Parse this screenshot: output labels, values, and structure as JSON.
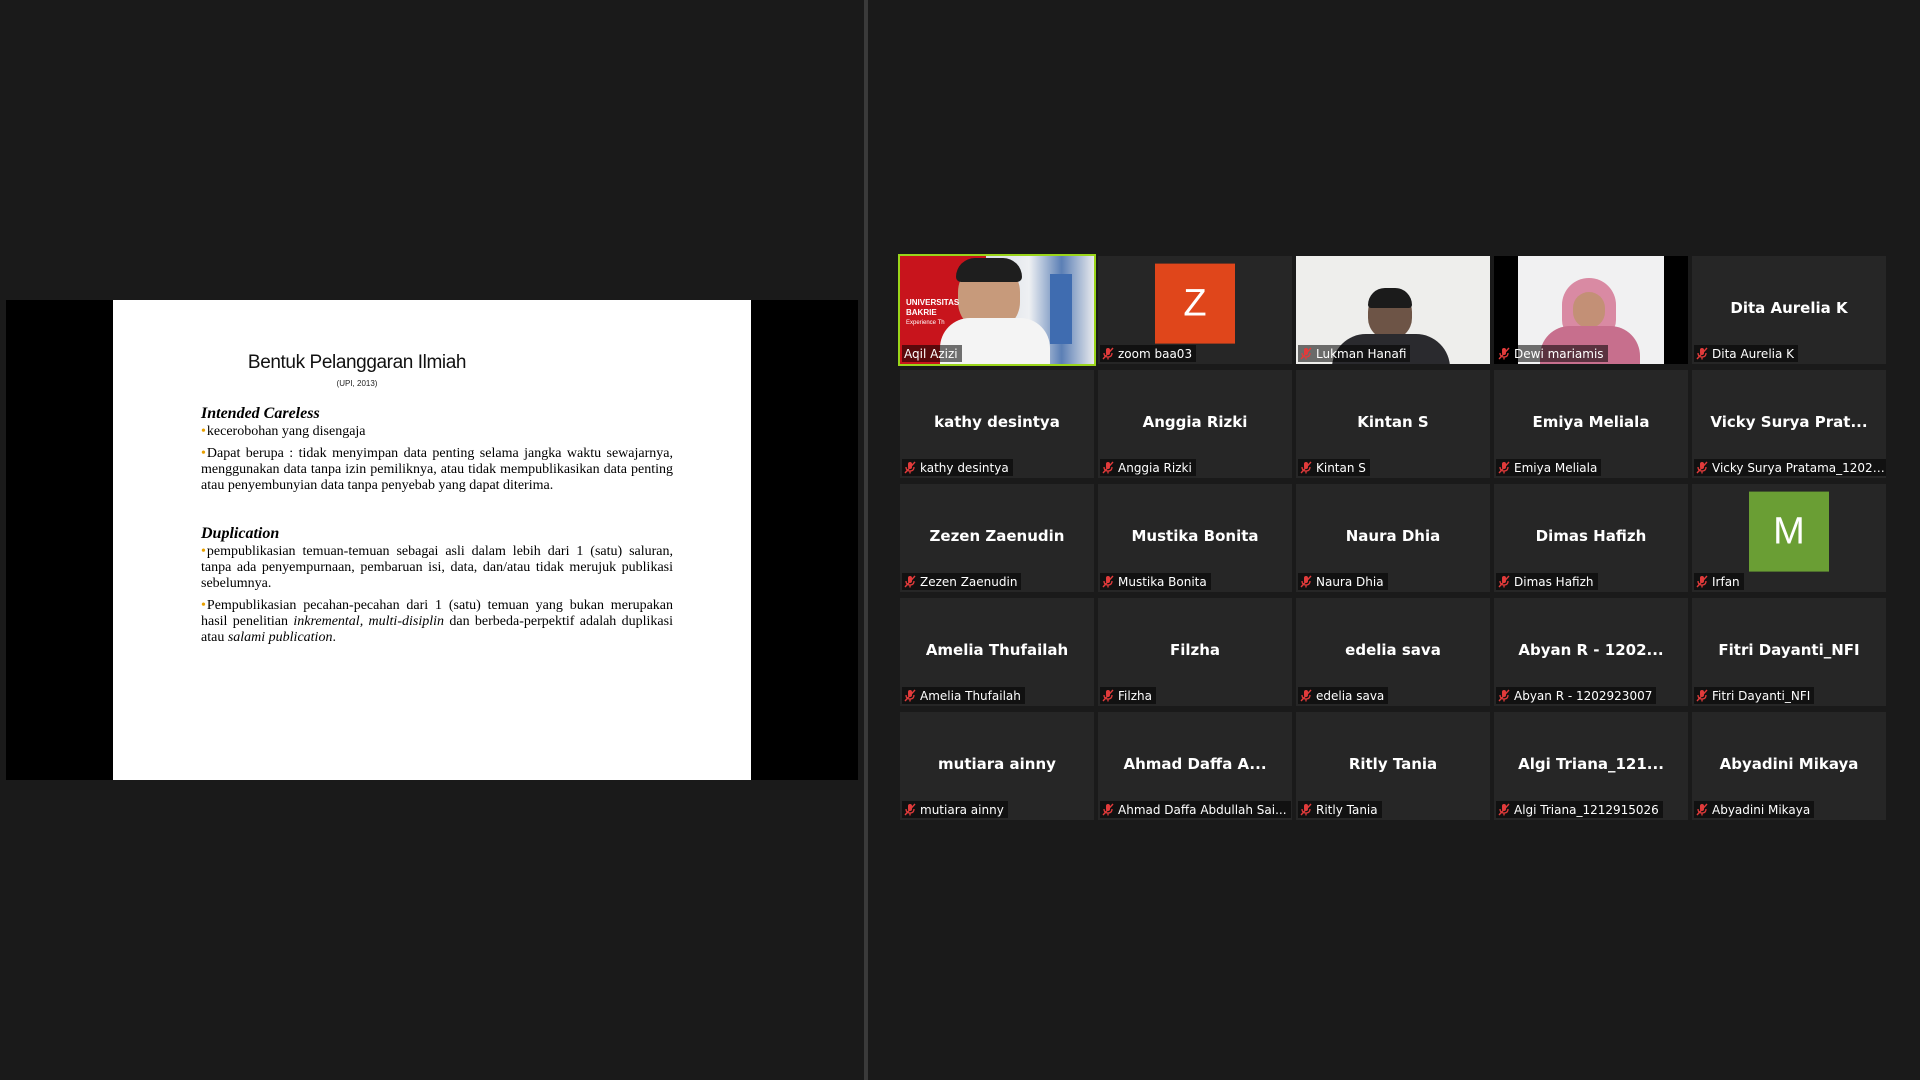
{
  "slide": {
    "title": "Bentuk Pelanggaran Ilmiah",
    "source": "(UPI, 2013)",
    "section1": {
      "heading": "Intended Careless",
      "bullet1": "kecerobohan yang disengaja",
      "bullet2": "Dapat berupa : tidak menyimpan data penting selama jangka waktu sewajarnya, menggunakan data tanpa izin pemiliknya, atau tidak mempublikasikan data penting atau penyembunyian data tanpa penyebab yang dapat diterima."
    },
    "section2": {
      "heading": "Duplication",
      "bullet1": "pempublikasian temuan-temuan sebagai asli dalam lebih dari 1 (satu) saluran, tanpa ada penyempurnaan, pembaruan isi, data, dan/atau tidak merujuk publikasi sebelumnya.",
      "bullet2_a": "Pempublikasian pecahan-pecahan dari 1 (satu) temuan yang bukan merupakan hasil penelitian ",
      "bullet2_b": "inkremental, multi-disiplin",
      "bullet2_c": " dan berbeda-perpektif adalah duplikasi atau ",
      "bullet2_d": "salami publication",
      "bullet2_e": "."
    }
  },
  "video_banner": {
    "line1": "UNIVERSITAS",
    "line2": "BAKRIE",
    "line3": "Experience Th"
  },
  "participants": [
    {
      "label": "Aqil Azizi"
    },
    {
      "label": "zoom baa03",
      "avatar": "Z"
    },
    {
      "label": "Lukman Hanafi"
    },
    {
      "label": "Dewi mariamis"
    },
    {
      "label": "Dita Aurelia K",
      "center": "Dita Aurelia K"
    },
    {
      "label": "kathy desintya",
      "center": "kathy desintya"
    },
    {
      "label": "Anggia Rizki",
      "center": "Anggia Rizki"
    },
    {
      "label": "Kintan S",
      "center": "Kintan S"
    },
    {
      "label": "Emiya Meliala",
      "center": "Emiya Meliala"
    },
    {
      "label": "Vicky Surya Pratama_12029...",
      "center": "Vicky  Surya  Prat..."
    },
    {
      "label": "Zezen Zaenudin",
      "center": "Zezen Zaenudin"
    },
    {
      "label": "Mustika Bonita",
      "center": "Mustika Bonita"
    },
    {
      "label": "Naura Dhia",
      "center": "Naura Dhia"
    },
    {
      "label": "Dimas Hafizh",
      "center": "Dimas Hafizh"
    },
    {
      "label": "Irfan",
      "avatar": "M"
    },
    {
      "label": "Amelia Thufailah",
      "center": "Amelia Thufailah"
    },
    {
      "label": "Filzha",
      "center": "Filzha"
    },
    {
      "label": "edelia sava",
      "center": "edelia sava"
    },
    {
      "label": "Abyan R - 1202923007",
      "center": "Abyan R - 1202..."
    },
    {
      "label": "Fitri Dayanti_NFI",
      "center": "Fitri Dayanti_NFI"
    },
    {
      "label": "mutiara ainny",
      "center": "mutiara ainny"
    },
    {
      "label": "Ahmad Daffa Abdullah Sai...",
      "center": "Ahmad Daffa A..."
    },
    {
      "label": "Ritly Tania",
      "center": "Ritly Tania"
    },
    {
      "label": "Algi Triana_1212915026",
      "center": "Algi  Triana_121..."
    },
    {
      "label": "Abyadini Mikaya",
      "center": "Abyadini Mikaya"
    }
  ],
  "colors": {
    "active_speaker": "#9ad41a",
    "avatar_z": "#e0461b",
    "avatar_m": "#6a9e34",
    "bullet": "#e8a000",
    "muted_icon": "#e23b3b"
  }
}
